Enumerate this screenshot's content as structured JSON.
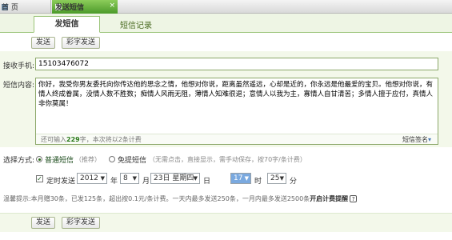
{
  "browser_tabs": {
    "home": "首 页",
    "sms": "发送短信",
    "close": "×"
  },
  "subtabs": {
    "send": "发短信",
    "history": "短信记录"
  },
  "buttons": {
    "send": "发送",
    "color_send": "彩字发送"
  },
  "form": {
    "phone_label": "接收手机:",
    "phone_value": "15103476072",
    "content_label": "短信内容:",
    "content_value": "你好，我受你男友委托向你传达他的思念之情，他想对你说，距离虽然遥远，心却是近的，你永远是他最爱的宝贝。他想对你说，有情人终成眷属，没情人数不胜数；痴情人风雨无阻，薄情人知难很退；意情人以我为主，寡情人自甘清苦；多情人擅于应付，真情人非你莫属！",
    "count_prefix": "还可输入",
    "count_value": "229",
    "count_suffix": "字，本次将以2条计费",
    "signature": "短信签名",
    "signature_arrow": "▾",
    "method_label": "选择方式:",
    "method_normal": "普通短信",
    "method_normal_note": "（推荐）",
    "method_free": "免提短信",
    "method_free_note": "（无需点击，直接显示，需手动保存，按70字/条计费）",
    "schedule_label": "定时发送",
    "schedule_checked": "✓",
    "year": "2012",
    "year_unit": "年",
    "month": "8",
    "month_unit": "月",
    "day": "23日 星期四",
    "day_unit": "日",
    "hour": "17",
    "hour_unit": "时",
    "minute": "25",
    "minute_unit": "分",
    "select_arrow": "▼"
  },
  "note": {
    "text": "温馨提示:本月赠30条，已发125条，超出按0.1元/条计费。一天内最多发送250条，一月内最多发送2500条",
    "link": "开启计费提醒",
    "help": "?"
  },
  "colors": {
    "accent_green": "#4b9a2a",
    "panel_bg": "#f3f8ea",
    "hour_highlight": "#7aa9df"
  }
}
